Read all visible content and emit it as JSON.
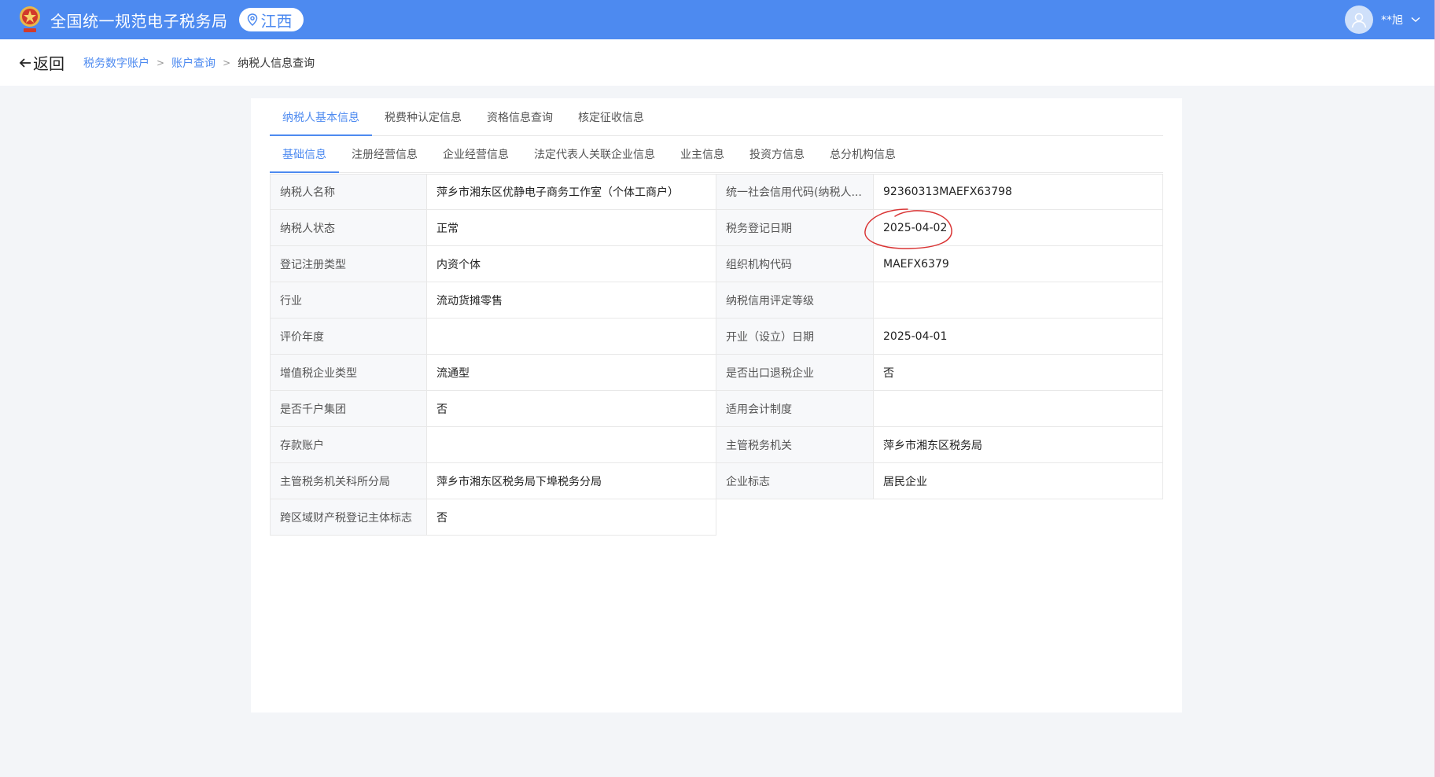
{
  "header": {
    "app_title": "全国统一规范电子税务局",
    "region": "江西",
    "user_name": "**旭",
    "logo_icon": "tax-emblem-icon",
    "location_icon": "map-pin-icon",
    "dropdown_icon": "chevron-down-icon"
  },
  "subheader": {
    "back_label": "返回",
    "breadcrumb": [
      "税务数字账户",
      "账户查询",
      "纳税人信息查询"
    ]
  },
  "tabs_primary": [
    "纳税人基本信息",
    "税费种认定信息",
    "资格信息查询",
    "核定征收信息"
  ],
  "tabs_primary_active": 0,
  "tabs_secondary": [
    "基础信息",
    "注册经营信息",
    "企业经营信息",
    "法定代表人关联企业信息",
    "业主信息",
    "投资方信息",
    "总分机构信息"
  ],
  "tabs_secondary_active": 0,
  "info_rows": [
    [
      {
        "label": "纳税人名称",
        "value": "萍乡市湘东区优静电子商务工作室（个体工商户）"
      },
      {
        "label": "统一社会信用代码(纳税人...",
        "value": "92360313MAEFX63798"
      }
    ],
    [
      {
        "label": "纳税人状态",
        "value": "正常"
      },
      {
        "label": "税务登记日期",
        "value": "2025-04-02"
      }
    ],
    [
      {
        "label": "登记注册类型",
        "value": "内资个体"
      },
      {
        "label": "组织机构代码",
        "value": "MAEFX6379"
      }
    ],
    [
      {
        "label": "行业",
        "value": "流动货摊零售"
      },
      {
        "label": "纳税信用评定等级",
        "value": ""
      }
    ],
    [
      {
        "label": "评价年度",
        "value": ""
      },
      {
        "label": "开业（设立）日期",
        "value": "2025-04-01"
      }
    ],
    [
      {
        "label": "增值税企业类型",
        "value": "流通型"
      },
      {
        "label": "是否出口退税企业",
        "value": "否"
      }
    ],
    [
      {
        "label": "是否千户集团",
        "value": "否"
      },
      {
        "label": "适用会计制度",
        "value": ""
      }
    ],
    [
      {
        "label": "存款账户",
        "value": ""
      },
      {
        "label": "主管税务机关",
        "value": "萍乡市湘东区税务局"
      }
    ],
    [
      {
        "label": "主管税务机关科所分局",
        "value": "萍乡市湘东区税务局下埠税务分局"
      },
      {
        "label": "企业标志",
        "value": "居民企业"
      }
    ],
    [
      {
        "label": "跨区域财产税登记主体标志",
        "value": "否"
      }
    ]
  ],
  "colors": {
    "brand": "#4d8af0",
    "annotation": "#d93434"
  }
}
